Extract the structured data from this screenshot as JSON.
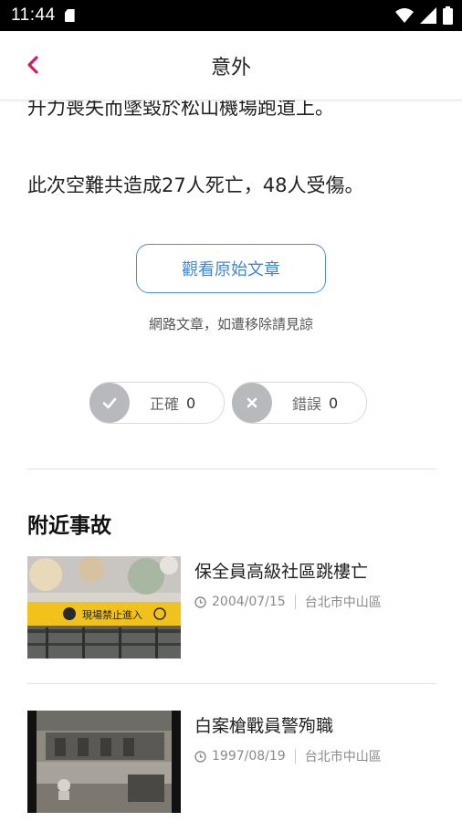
{
  "status_bar": {
    "time": "11:44"
  },
  "header": {
    "title": "意外"
  },
  "article": {
    "cut_line": "升力喪失而墜毀於松山機場跑道上。",
    "casualty_line": "此次空難共造成27人死亡，48人受傷。",
    "original_button": "觀看原始文章",
    "notice": "網路文章，如遭移除請見諒"
  },
  "votes": {
    "correct": {
      "label": "正確",
      "count": "0"
    },
    "wrong": {
      "label": "錯誤",
      "count": "0"
    }
  },
  "nearby": {
    "section_title": "附近事故",
    "items": [
      {
        "title": "保全員高級社區跳樓亡",
        "date": "2004/07/15",
        "district": "台北市中山區",
        "thumb_caption": "現場禁止進入"
      },
      {
        "title": "白案槍戰員警殉職",
        "date": "1997/08/19",
        "district": "台北市中山區"
      }
    ]
  },
  "colors": {
    "accent": "#d81b60",
    "link_blue": "#3f87d6",
    "vote_gray": "#b7b9bd"
  }
}
